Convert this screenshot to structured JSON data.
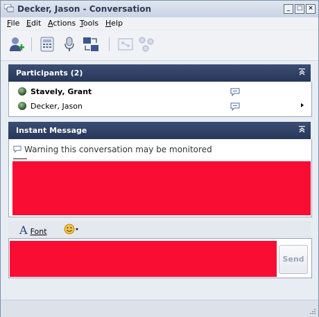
{
  "window": {
    "title": "Decker, Jason - Conversation"
  },
  "menu": [
    {
      "label": "File",
      "accel": "F",
      "rest": "ile"
    },
    {
      "label": "Edit",
      "accel": "E",
      "rest": "dit"
    },
    {
      "label": "Actions",
      "accel": "A",
      "rest": "ctions"
    },
    {
      "label": "Tools",
      "accel": "T",
      "rest": "ools"
    },
    {
      "label": "Help",
      "accel": "H",
      "rest": "elp"
    }
  ],
  "toolbar": {
    "icons": [
      "add-contact-icon",
      "dialpad-icon",
      "microphone-icon",
      "share-screen-icon",
      "whiteboard-icon",
      "network-icon"
    ]
  },
  "participants": {
    "header": "Participants (2)",
    "items": [
      {
        "name": "Stavely, Grant"
      },
      {
        "name": "Decker, Jason"
      }
    ]
  },
  "instant_message": {
    "header": "Instant Message",
    "warning": "Warning this conversation may be monitored"
  },
  "format": {
    "font_label": "Font",
    "font_accel": "o"
  },
  "compose": {
    "send_label": "Send"
  },
  "colors": {
    "header_bg": "#2d3f66",
    "redaction": "#fa0d33"
  }
}
